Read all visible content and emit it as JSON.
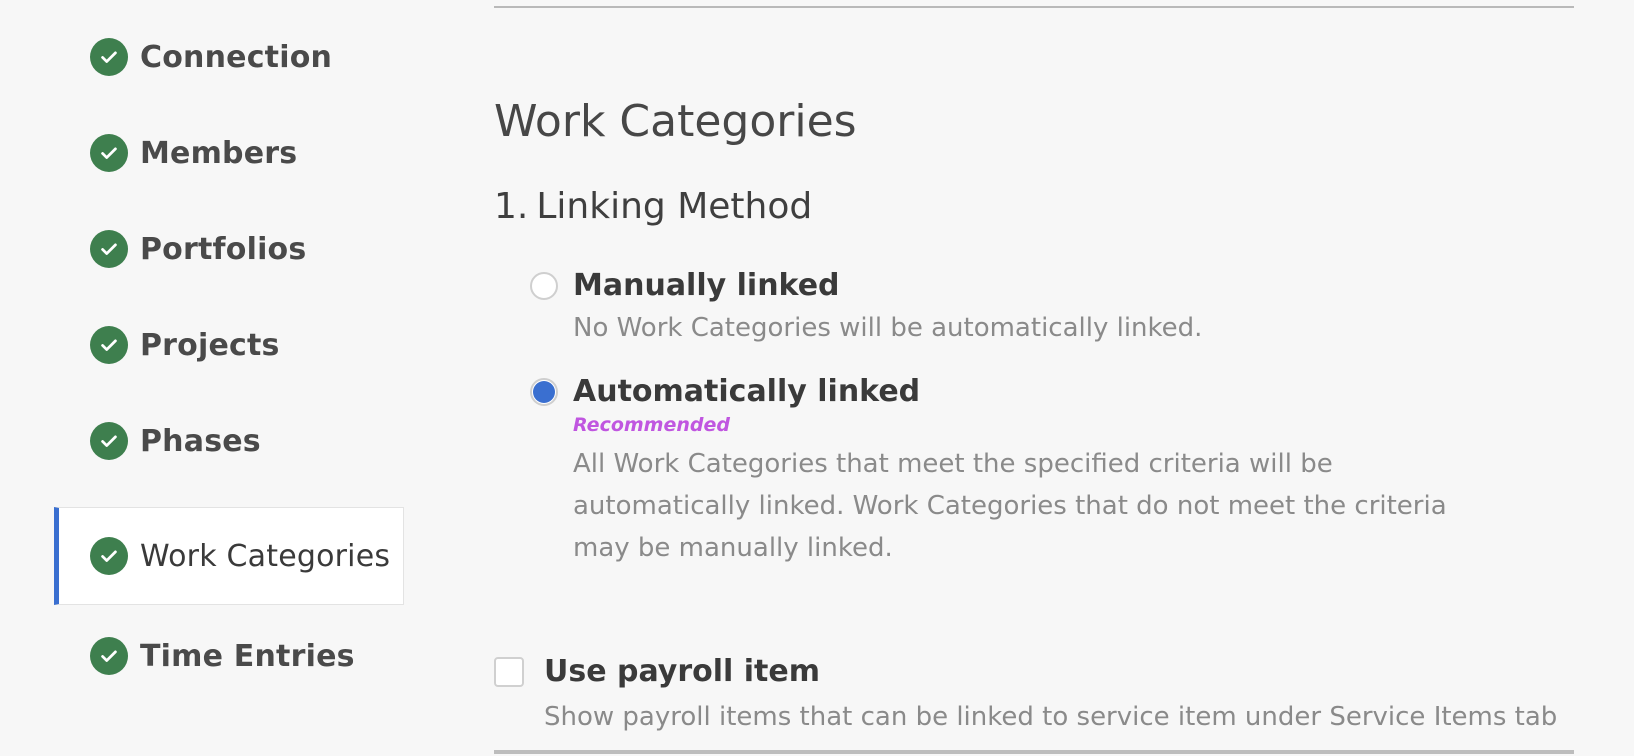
{
  "sidebar": {
    "items": [
      {
        "label": "Connection",
        "icon": "check-circle-icon",
        "status": "complete",
        "active": false
      },
      {
        "label": "Members",
        "icon": "check-circle-icon",
        "status": "complete",
        "active": false
      },
      {
        "label": "Portfolios",
        "icon": "check-circle-icon",
        "status": "complete",
        "active": false
      },
      {
        "label": "Projects",
        "icon": "check-circle-icon",
        "status": "complete",
        "active": false
      },
      {
        "label": "Phases",
        "icon": "check-circle-icon",
        "status": "complete",
        "active": false
      },
      {
        "label": "Work Categories",
        "icon": "check-circle-icon",
        "status": "complete",
        "active": true
      },
      {
        "label": "Time Entries",
        "icon": "check-circle-icon",
        "status": "complete",
        "active": false
      }
    ]
  },
  "main": {
    "title": "Work Categories",
    "step": {
      "number": "1.",
      "title": "Linking Method"
    },
    "linking_options": [
      {
        "label": "Manually linked",
        "checked": false,
        "description": "No Work Categories will be automatically linked."
      },
      {
        "label": "Automatically linked",
        "checked": true,
        "badge": "Recommended",
        "description": "All Work Categories that meet the specified criteria will be automatically linked. Work Categories that do not meet the criteria may be manually linked."
      }
    ],
    "payroll": {
      "label": "Use payroll item",
      "checked": false,
      "description": "Show payroll items that can be linked to service item under Service Items tab"
    }
  },
  "colors": {
    "check_green": "#3e7f4e",
    "active_accent": "#3a6fd0",
    "radio_selected": "#3a6fd0",
    "recommended": "#c056e0",
    "background": "#f7f7f7"
  }
}
